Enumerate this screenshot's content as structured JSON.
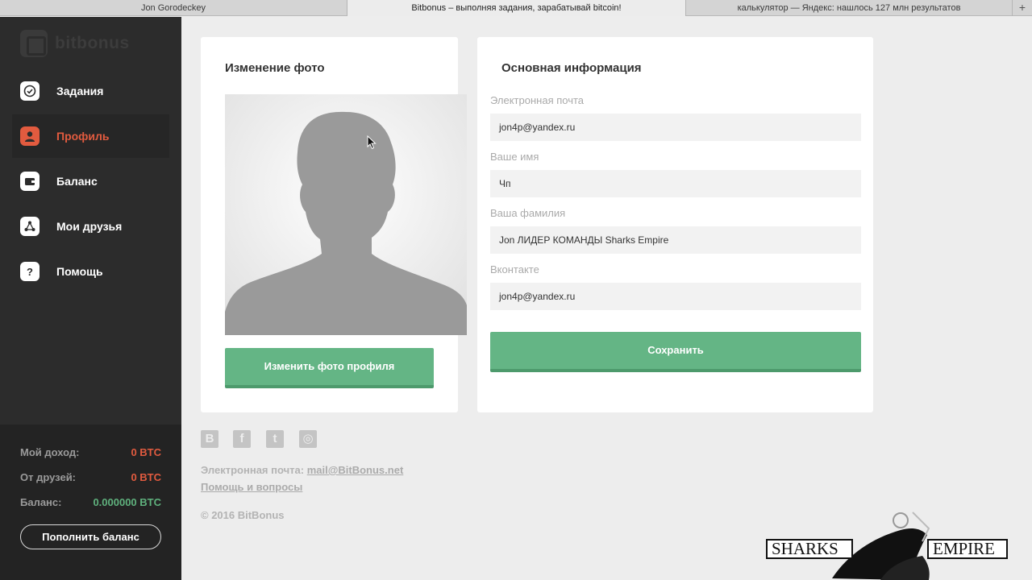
{
  "browser": {
    "tabs": [
      {
        "title": "Jon Gorodeckey"
      },
      {
        "title": "Bitbonus – выполняя задания, зарабатывай bitcoin!"
      },
      {
        "title": "калькулятор — Яндекс: нашлось 127 млн результатов"
      }
    ],
    "new_tab_label": "+"
  },
  "sidebar": {
    "logo_text": "bitbonus",
    "items": [
      {
        "label": "Задания",
        "icon": "check-circle-icon"
      },
      {
        "label": "Профиль",
        "icon": "user-icon"
      },
      {
        "label": "Баланс",
        "icon": "wallet-icon"
      },
      {
        "label": "Мои друзья",
        "icon": "network-icon"
      },
      {
        "label": "Помощь",
        "icon": "question-icon"
      }
    ],
    "active_index": 1,
    "stats": {
      "income_label": "Мой доход:",
      "income_value": "0 BTC",
      "friends_label": "От друзей:",
      "friends_value": "0 BTC",
      "balance_label": "Баланс:",
      "balance_value": "0.000000 BTC"
    },
    "topup_label": "Пополнить баланс"
  },
  "photo_card": {
    "title": "Изменение фото",
    "change_button": "Изменить фото профиля"
  },
  "info_card": {
    "title": "Основная информация",
    "fields": {
      "email": {
        "label": "Электронная почта",
        "value": "jon4p@yandex.ru"
      },
      "first_name": {
        "label": "Ваше имя",
        "value": "Чп"
      },
      "last_name": {
        "label": "Ваша фамилия",
        "value": "Jon ЛИДЕР КОМАНДЫ Sharks Empire"
      },
      "vk": {
        "label": "Вконтакте",
        "value": "jon4p@yandex.ru"
      }
    },
    "save_button": "Сохранить"
  },
  "footer": {
    "social": [
      {
        "name": "vk-icon",
        "glyph": "B"
      },
      {
        "name": "facebook-icon",
        "glyph": "f"
      },
      {
        "name": "twitter-icon",
        "glyph": "t"
      },
      {
        "name": "instagram-icon",
        "glyph": "◎"
      }
    ],
    "email_label": "Электронная почта:",
    "email_value": "mail@BitBonus.net",
    "help_link": "Помощь и вопросы",
    "copyright": "© 2016 BitBonus"
  },
  "watermark": {
    "left_text": "SHARKS",
    "right_text": "EMPIRE"
  },
  "colors": {
    "accent": "#e25b3f",
    "success": "#64b585",
    "sidebar": "#2c2c2c",
    "background": "#ededed"
  }
}
